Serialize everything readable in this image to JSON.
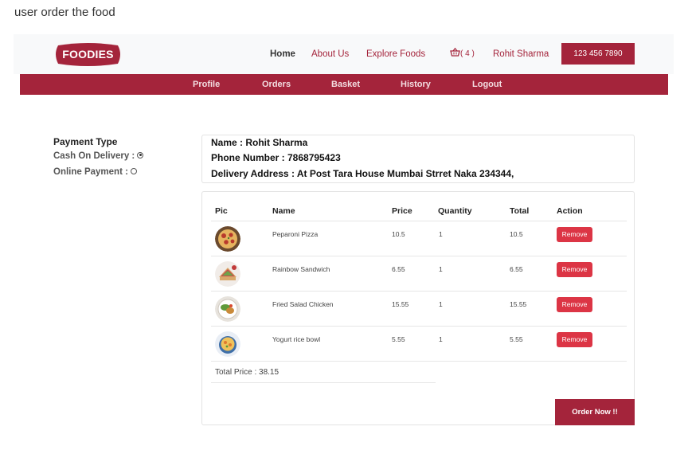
{
  "caption": "user order the food",
  "header": {
    "logo_text": "FOODIES",
    "nav": {
      "home": "Home",
      "about": "About Us",
      "explore": "Explore Foods",
      "cart_count": "( 4 )",
      "user": "Rohit Sharma"
    },
    "phone": "123 456 7890"
  },
  "subnav": {
    "profile": "Profile",
    "orders": "Orders",
    "basket": "Basket",
    "history": "History",
    "logout": "Logout"
  },
  "payment": {
    "title": "Payment Type",
    "options": [
      {
        "label": "Cash On Delivery :",
        "selected": true
      },
      {
        "label": "Online Payment :",
        "selected": false
      }
    ]
  },
  "customer": {
    "name": "Name : Rohit Sharma",
    "phone": "Phone Number : 7868795423",
    "address": "Delivery Address : At Post Tara House Mumbai Strret Naka 234344,"
  },
  "table": {
    "headers": {
      "pic": "Pic",
      "name": "Name",
      "price": "Price",
      "quantity": "Quantity",
      "total": "Total",
      "action": "Action"
    },
    "rows": [
      {
        "name": "Peparoni Pizza",
        "price": "10.5",
        "quantity": "1",
        "total": "10.5",
        "action": "Remove",
        "pic_icon": "pizza-icon"
      },
      {
        "name": "Rainbow Sandwich",
        "price": "6.55",
        "quantity": "1",
        "total": "6.55",
        "action": "Remove",
        "pic_icon": "sandwich-icon"
      },
      {
        "name": "Fried Salad Chicken",
        "price": "15.55",
        "quantity": "1",
        "total": "15.55",
        "action": "Remove",
        "pic_icon": "salad-icon"
      },
      {
        "name": "Yogurt rice bowl",
        "price": "5.55",
        "quantity": "1",
        "total": "5.55",
        "action": "Remove",
        "pic_icon": "rice-bowl-icon"
      }
    ],
    "total_price": "Total Price : 38.15"
  },
  "order_button": "Order Now !!",
  "colors": {
    "brand": "#a4243b",
    "danger": "#dc3545",
    "topbar_bg": "#f8f9fa"
  }
}
